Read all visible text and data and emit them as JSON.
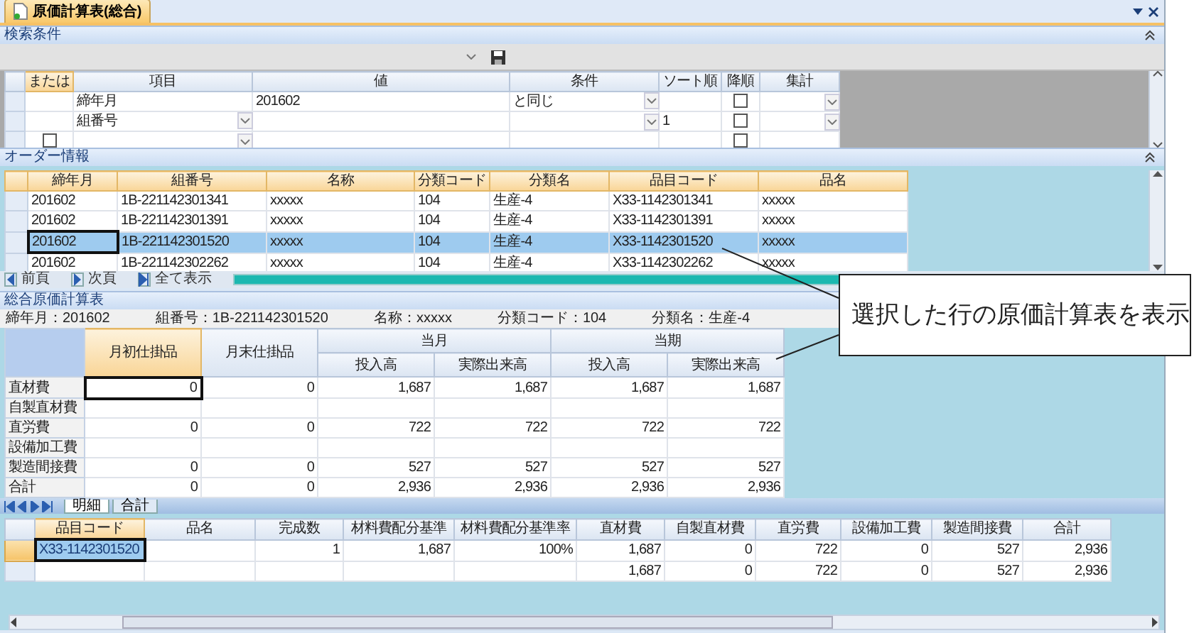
{
  "document_tab": {
    "title": "原価計算表(総合)",
    "selected": true
  },
  "search_panel": {
    "title": "検索条件",
    "columns": [
      "または",
      "項目",
      "値",
      "条件",
      "ソート順",
      "降順",
      "集計"
    ],
    "rows": [
      {
        "item": "締年月",
        "value": "201602",
        "condition": "と同じ",
        "item_dropdown": false,
        "editors": true,
        "descending": false
      },
      {
        "item": "組番号",
        "sort": "1",
        "item_dropdown": true,
        "editors": true,
        "descending": false
      },
      {
        "or_checked": false,
        "item_dropdown": true,
        "editors": false,
        "descending": false
      }
    ]
  },
  "order_panel": {
    "title": "オーダー情報",
    "columns": [
      "締年月",
      "組番号",
      "名称",
      "分類コード",
      "分類名",
      "品目コード",
      "品名"
    ],
    "rows": [
      {
        "cells": [
          "201602",
          "1B-221142301341",
          "xxxxx",
          "104",
          "生産-4",
          "X33-1142301341",
          "xxxxx"
        ],
        "selected": false
      },
      {
        "cells": [
          "201602",
          "1B-221142301391",
          "xxxxx",
          "104",
          "生産-4",
          "X33-1142301391",
          "xxxxx"
        ],
        "selected": false
      },
      {
        "cells": [
          "201602",
          "1B-221142301520",
          "xxxxx",
          "104",
          "生産-4",
          "X33-1142301520",
          "xxxxx"
        ],
        "selected": true
      },
      {
        "cells": [
          "201602",
          "1B-221142302262",
          "xxxxx",
          "104",
          "生産-4",
          "X33-1142302262",
          "xxxxx"
        ],
        "selected": false
      }
    ],
    "pager": [
      "前頁",
      "次頁",
      "全て表示"
    ],
    "progress": {
      "level": 1
    }
  },
  "cost_panel": {
    "title": "総合原価計算表",
    "info": [
      "締年月：201602",
      "組番号：1B-221142301520",
      "名称：xxxxx",
      "分類コード：104",
      "分類名：生産-4"
    ],
    "single_columns": [
      {
        "label": "月初仕掛品",
        "selected": true
      },
      {
        "label": "月末仕掛品",
        "selected": false
      }
    ],
    "groups": [
      {
        "label": "当月",
        "columns": [
          "投入高",
          "実際出来高"
        ]
      },
      {
        "label": "当期",
        "columns": [
          "投入高",
          "実際出来高"
        ]
      }
    ],
    "rows": [
      {
        "label": "直材費",
        "values": [
          "0",
          "0",
          "1,687",
          "1,687",
          "1,687",
          "1,687"
        ],
        "focused": true
      },
      {
        "label": "自製直材費",
        "focused": false
      },
      {
        "label": "直労費",
        "values": [
          "0",
          "0",
          "722",
          "722",
          "722",
          "722"
        ],
        "focused": false
      },
      {
        "label": "設備加工費",
        "focused": false
      },
      {
        "label": "製造間接費",
        "values": [
          "0",
          "0",
          "527",
          "527",
          "527",
          "527"
        ],
        "focused": false
      },
      {
        "label": "合計",
        "values": [
          "0",
          "0",
          "2,936",
          "2,936",
          "2,936",
          "2,936"
        ],
        "focused": false
      }
    ]
  },
  "sheet_tabs": [
    {
      "label": "明細",
      "selected": true
    },
    {
      "label": "合計",
      "selected": false
    }
  ],
  "detail_grid": {
    "columns": [
      "品目コード",
      "品名",
      "完成数",
      "材料費配分基準",
      "材料費配分基準率",
      "直材費",
      "自製直材費",
      "直労費",
      "設備加工費",
      "製造間接費",
      "合計"
    ],
    "rows": [
      {
        "cells": [
          "X33-1142301520",
          null,
          "1",
          "1,687",
          "100%",
          "1,687",
          "0",
          "722",
          "0",
          "527",
          "2,936"
        ],
        "selected": true
      },
      {
        "cells": [
          null,
          null,
          null,
          null,
          null,
          "1,687",
          "0",
          "722",
          "0",
          "527",
          "2,936"
        ],
        "selected": false
      }
    ]
  },
  "callout": {
    "text": "選択した行の原価計算表を表示"
  }
}
